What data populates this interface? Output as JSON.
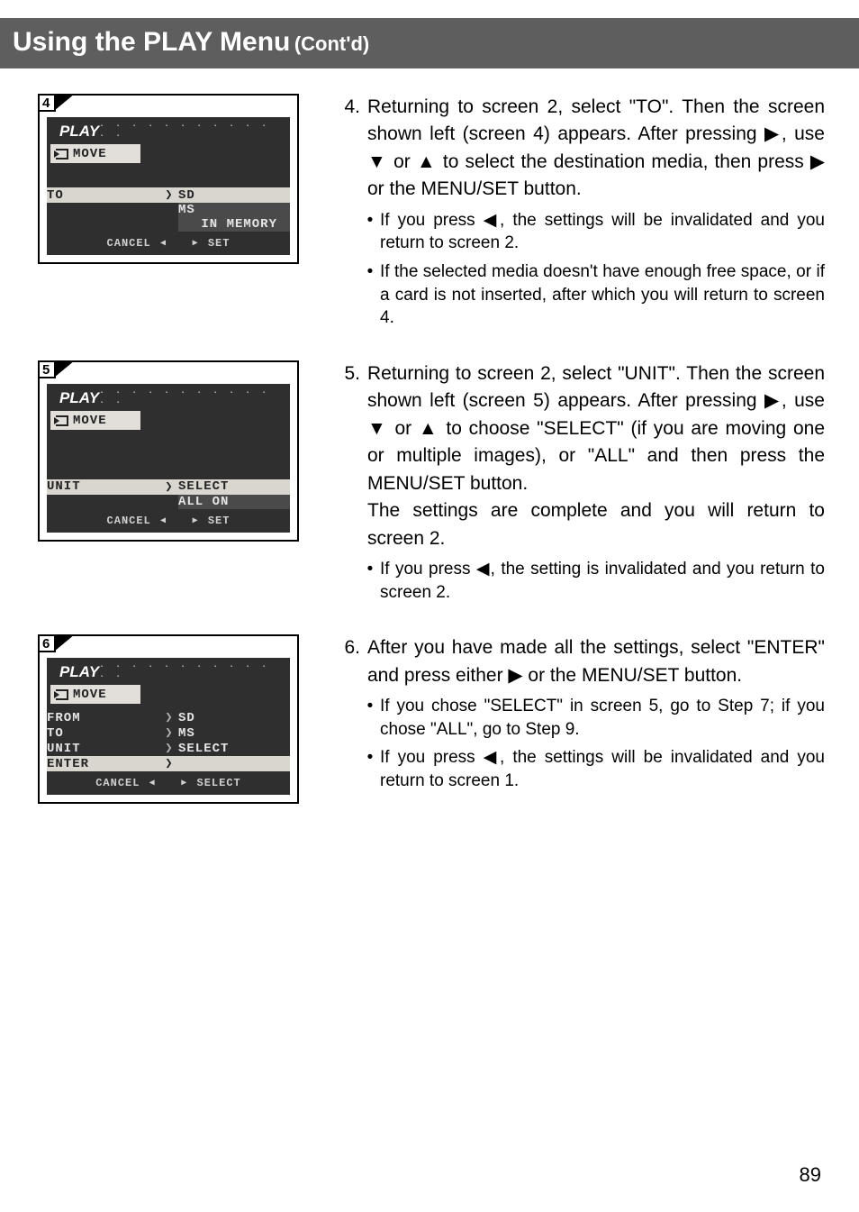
{
  "header": {
    "main": "Using the PLAY Menu",
    "sub": "(Cont'd)"
  },
  "page_number": "89",
  "screens": {
    "s4": {
      "tag": "4",
      "title": "PLAY",
      "dots": "· · · · · · · · · · · · ·",
      "tab": "MOVE",
      "row_label": "TO",
      "options": [
        "SD",
        "MS",
        "IN MEMORY"
      ],
      "foot_left": "CANCEL",
      "foot_right": "SET"
    },
    "s5": {
      "tag": "5",
      "title": "PLAY",
      "dots": "· · · · · · · · · · · · ·",
      "tab": "MOVE",
      "row_label": "UNIT",
      "options": [
        "SELECT",
        "ALL ON"
      ],
      "foot_left": "CANCEL",
      "foot_right": "SET"
    },
    "s6": {
      "tag": "6",
      "title": "PLAY",
      "dots": "· · · · · · · · · · · · ·",
      "tab": "MOVE",
      "rows": [
        {
          "label": "FROM",
          "value": "SD"
        },
        {
          "label": "TO",
          "value": "MS"
        },
        {
          "label": "UNIT",
          "value": "SELECT"
        },
        {
          "label": "ENTER",
          "value": ""
        }
      ],
      "foot_left": "CANCEL",
      "foot_right": "SELECT"
    }
  },
  "steps": {
    "s4": {
      "num": "4.",
      "text": "Returning to screen 2, select \"TO\". Then the screen shown left (screen 4) appears. After pressing ▶, use ▼ or ▲ to select the destination media, then press ▶ or the MENU/SET button.",
      "bullets": [
        "If you press ◀, the settings will be invalidated and you return to screen 2.",
        "If the selected media doesn't have enough free space, or if a card is not inserted, after which you will return to screen 4."
      ]
    },
    "s5": {
      "num": "5.",
      "text": "Returning to screen 2, select \"UNIT\". Then the screen shown left (screen 5) appears. After pressing ▶, use ▼ or ▲ to choose \"SELECT\" (if you are moving one or multiple images), or \"ALL\" and then press the MENU/SET button.",
      "text2": "The settings are complete and you will return to screen 2.",
      "bullets": [
        "If you press ◀, the setting is invalidated and you return to screen 2."
      ]
    },
    "s6": {
      "num": "6.",
      "text": "After you have made all the settings, select \"ENTER\" and press either ▶ or the MENU/SET button.",
      "bullets": [
        "If you chose \"SELECT\" in screen 5, go to Step 7; if you chose \"ALL\", go to Step 9.",
        "If you press ◀, the settings will be invalidated and you return to screen 1."
      ]
    }
  }
}
